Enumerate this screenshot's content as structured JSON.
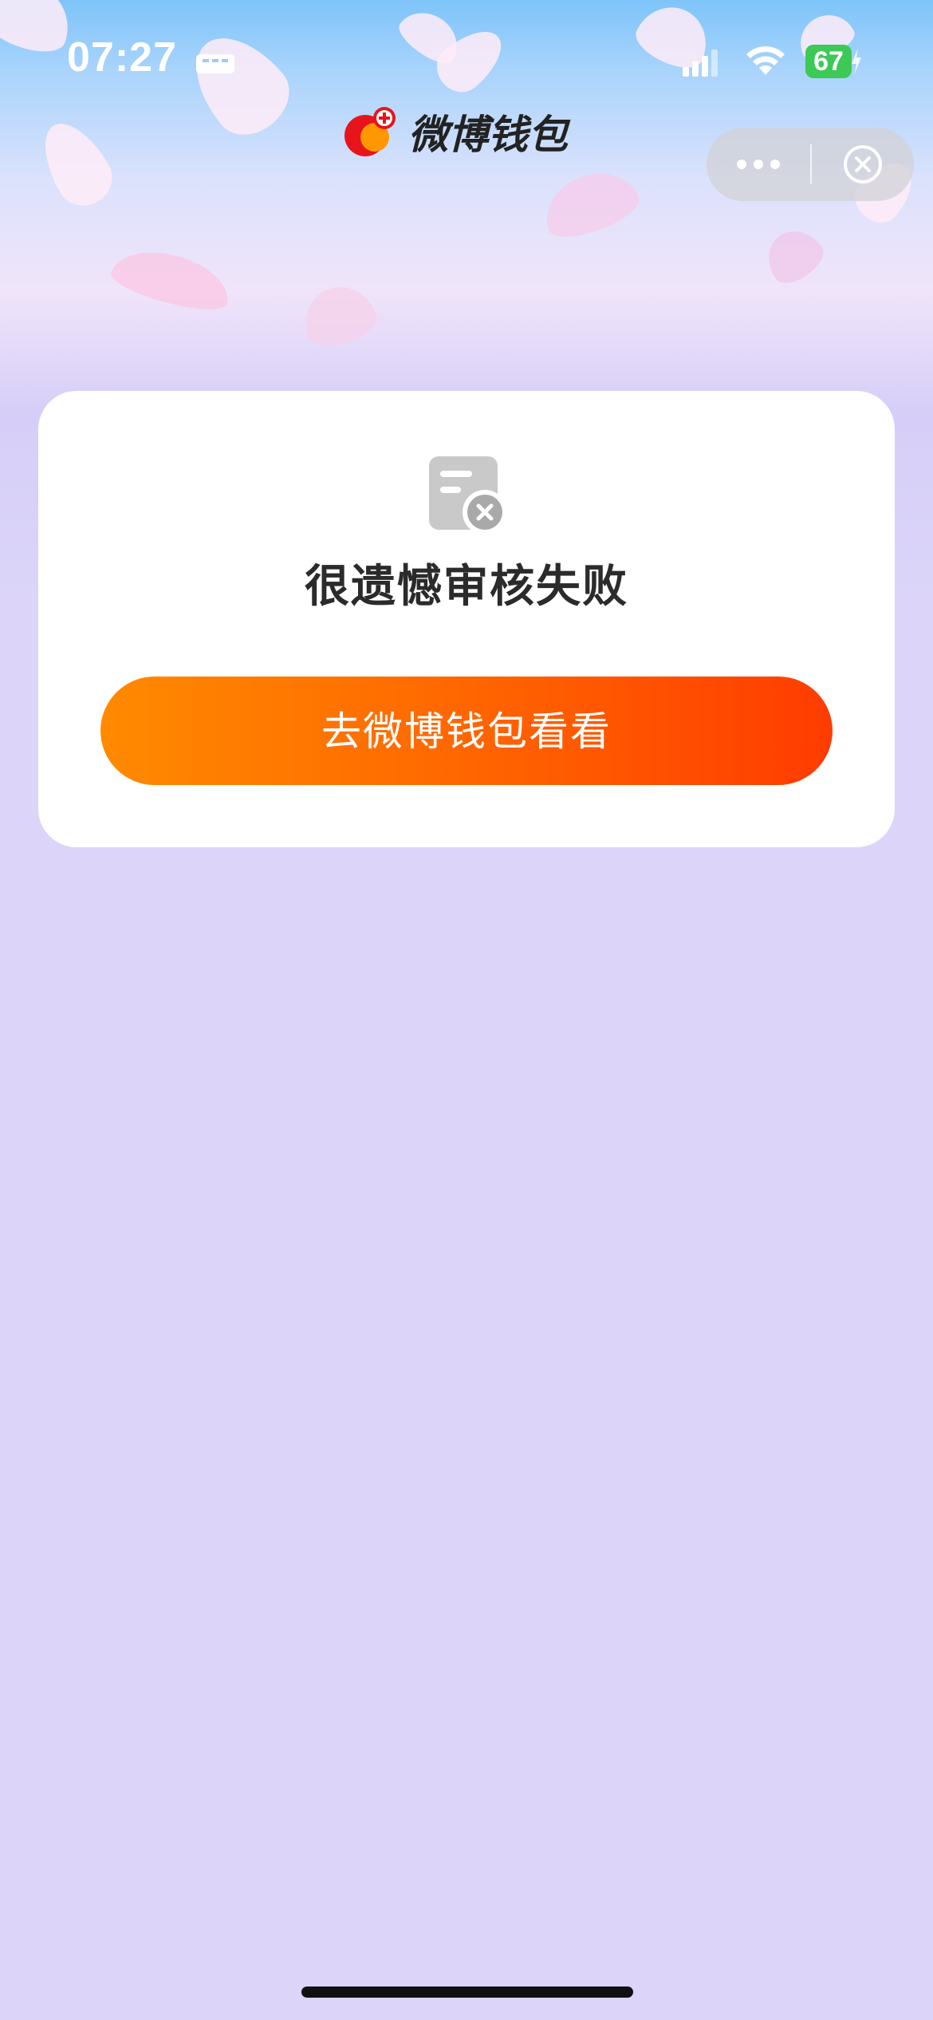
{
  "status_bar": {
    "time": "07:27",
    "battery": "67"
  },
  "header": {
    "brand_name": "微博钱包"
  },
  "result": {
    "title": "很遗憾审核失败",
    "button_label": "去微博钱包看看"
  },
  "colors": {
    "button_start": "#ff8a00",
    "button_end": "#ff3c00",
    "page_bg": "#dcd5f9",
    "battery": "#3dc956"
  }
}
